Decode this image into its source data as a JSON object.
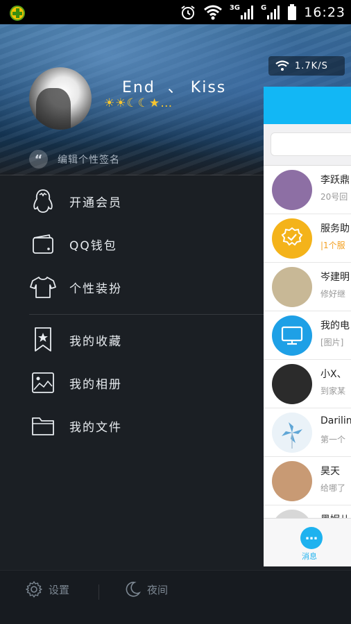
{
  "status_bar": {
    "net_1": "3G",
    "net_2": "G",
    "time": "16:23"
  },
  "profile": {
    "nickname": "End  、 Kiss",
    "level_icons": "☀☀☾☾★…",
    "signature_placeholder": "编辑个性签名",
    "quote_icon": "“"
  },
  "network_speed": "1.7K/S",
  "menu": [
    {
      "label": "开通会员",
      "icon": "penguin-icon"
    },
    {
      "label": "QQ钱包",
      "icon": "wallet-icon"
    },
    {
      "label": "个性装扮",
      "icon": "tshirt-icon"
    },
    {
      "label": "我的收藏",
      "icon": "bookmark-star-icon"
    },
    {
      "label": "我的相册",
      "icon": "photo-album-icon"
    },
    {
      "label": "我的文件",
      "icon": "folder-icon"
    }
  ],
  "bottom_bar": {
    "settings_label": "设置",
    "night_label": "夜间"
  },
  "chat_list": [
    {
      "name": "李跃鼎",
      "preview": "20号回",
      "avatar": "#8d6fa4"
    },
    {
      "name": "服务助",
      "preview": "|1个服",
      "avatar": "#f4b31a"
    },
    {
      "name": "岑建明",
      "preview": "修好继",
      "avatar": "#c8b896"
    },
    {
      "name": "我的电",
      "preview": "[图片]",
      "avatar": "#1ea0e6"
    },
    {
      "name": "小X、",
      "preview": "到家某",
      "avatar": "#2b2b2b"
    },
    {
      "name": "Darilin",
      "preview": "第一个",
      "avatar": "#eaf2f8"
    },
    {
      "name": "昊天",
      "preview": "给哪了",
      "avatar": "#c89a74"
    },
    {
      "name": "黑妮儿",
      "preview": "",
      "avatar": "#d7d7d7"
    }
  ],
  "tab_bar": {
    "messages_label": "消息",
    "messages_glyph": "…"
  },
  "colors": {
    "qq_blue": "#12b7f5",
    "drawer_bg": "#1b1f24",
    "accent_orange": "#f4a020"
  }
}
